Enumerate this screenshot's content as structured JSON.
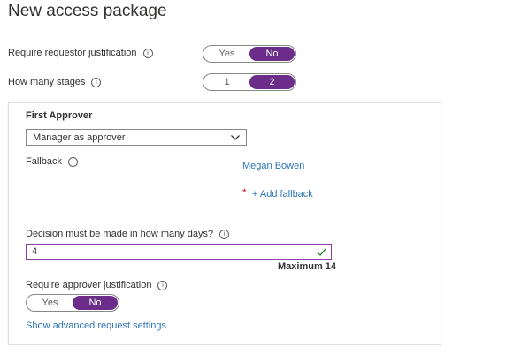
{
  "page": {
    "title": "New access package"
  },
  "require_requestor_justification": {
    "label": "Require requestor justification",
    "options": [
      "Yes",
      "No"
    ],
    "selected": "No"
  },
  "stages": {
    "label": "How many stages",
    "options": [
      "1",
      "2"
    ],
    "selected": "2"
  },
  "first_approver": {
    "title": "First Approver",
    "approver_dropdown": {
      "value": "Manager as approver"
    },
    "fallback": {
      "label": "Fallback",
      "person": "Megan Bowen",
      "required_marker": "*",
      "add_fallback_link": "+ Add fallback"
    },
    "decision_days": {
      "label": "Decision must be made in how many days?",
      "value": "4",
      "hint": "Maximum 14"
    },
    "require_approver_justification": {
      "label": "Require approver justification",
      "options": [
        "Yes",
        "No"
      ],
      "selected": "No"
    },
    "advanced_link": "Show advanced request settings"
  },
  "colors": {
    "accent_purple": "#6b2c8a",
    "link_blue": "#2e76b8",
    "input_focus_border": "#8d3ea6",
    "valid_check": "#107c10",
    "required_red": "#c50f1f"
  },
  "icons": {
    "info": "info-icon",
    "dropdown": "chevron-down-icon",
    "valid": "checkmark-icon"
  }
}
